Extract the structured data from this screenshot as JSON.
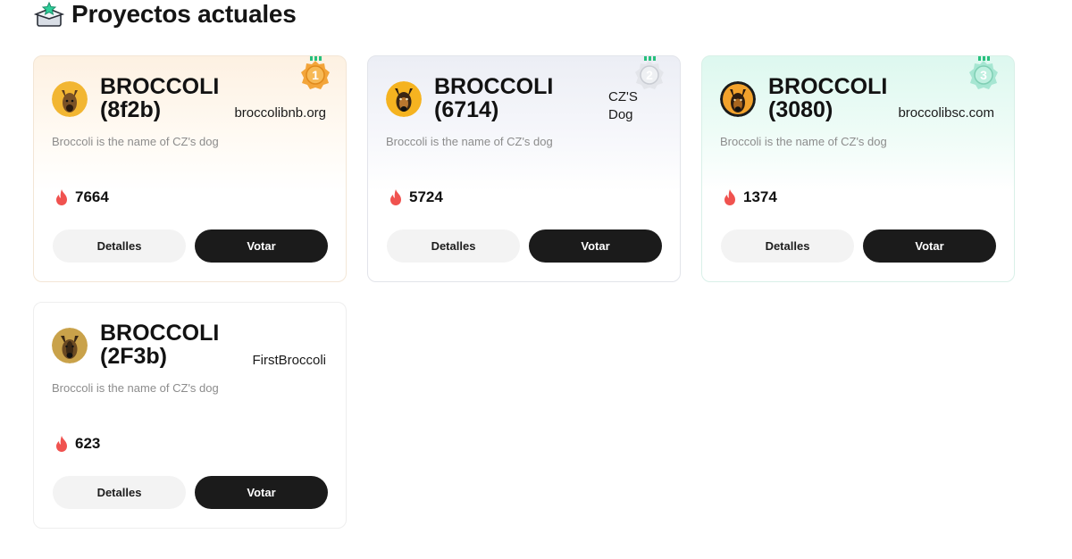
{
  "header": {
    "title": "Proyectos actuales",
    "icon": "trophy-box-icon"
  },
  "colors": {
    "vote_button": "#1b1b1b",
    "details_button": "#f3f3f3",
    "fire": "#f0524f",
    "gold": "#f3a53a",
    "silver": "#d9dce3",
    "bronze_teal": "#8fdcc4"
  },
  "projects": [
    {
      "rank": "1",
      "name": "BROCCOLI\n(8f2b)",
      "site": "broccolibnb.org",
      "description": "Broccoli is the name of CZ's dog",
      "votes": "7664",
      "details_label": "Detalles",
      "vote_label": "Votar"
    },
    {
      "rank": "2",
      "name": "BROCCOLI\n(6714)",
      "site": "CZ'S Dog",
      "description": "Broccoli is the name of CZ's dog",
      "votes": "5724",
      "details_label": "Detalles",
      "vote_label": "Votar"
    },
    {
      "rank": "3",
      "name": "BROCCOLI\n(3080)",
      "site": "broccolibsc.com",
      "description": "Broccoli is the name of CZ's dog",
      "votes": "1374",
      "details_label": "Detalles",
      "vote_label": "Votar"
    },
    {
      "rank": "",
      "name": "BROCCOLI\n(2F3b)",
      "site": "FirstBroccoli",
      "description": "Broccoli is the name of CZ's dog",
      "votes": "623",
      "details_label": "Detalles",
      "vote_label": "Votar"
    }
  ]
}
